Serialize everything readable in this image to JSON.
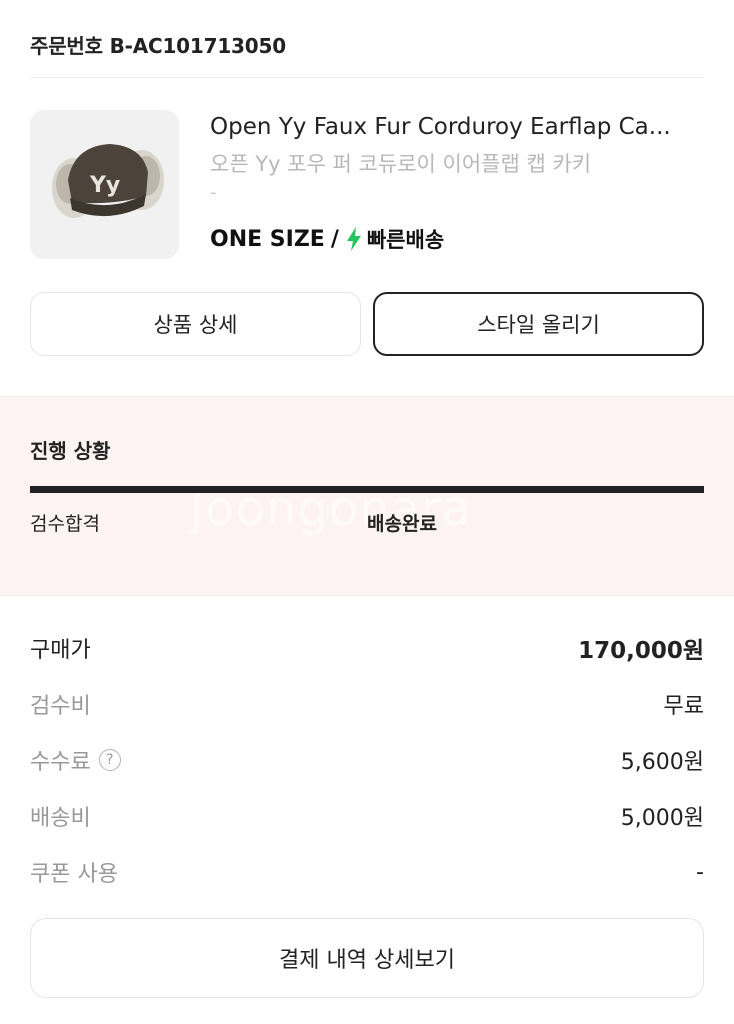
{
  "order": {
    "number_label": "주문번호 B-AC101713050"
  },
  "product": {
    "name_en": "Open Yy Faux Fur Corduroy Earflap Ca...",
    "name_ko": "오픈 Yy 포우 퍼 코듀로이 이어플랩 캡 카키",
    "option_dash": "-",
    "size": "ONE SIZE",
    "slash": "/",
    "delivery_type": "빠른배송",
    "image_text": "Yy"
  },
  "buttons": {
    "detail": "상품 상세",
    "style": "스타일 올리기",
    "receipt": "결제 내역 상세보기"
  },
  "progress": {
    "title": "진행 상황",
    "steps": [
      "검수합격",
      "배송완료"
    ],
    "watermark": "Joongonara"
  },
  "prices": {
    "purchase": {
      "label": "구매가",
      "value": "170,000원"
    },
    "inspection": {
      "label": "검수비",
      "value": "무료"
    },
    "fee": {
      "label": "수수료",
      "value": "5,600원",
      "help": "?"
    },
    "shipping": {
      "label": "배송비",
      "value": "5,000원"
    },
    "coupon": {
      "label": "쿠폰 사용",
      "value": "-"
    }
  },
  "colors": {
    "bolt": "#22c55e",
    "progress_bg": "#fdf3f2",
    "accent": "#222222"
  }
}
